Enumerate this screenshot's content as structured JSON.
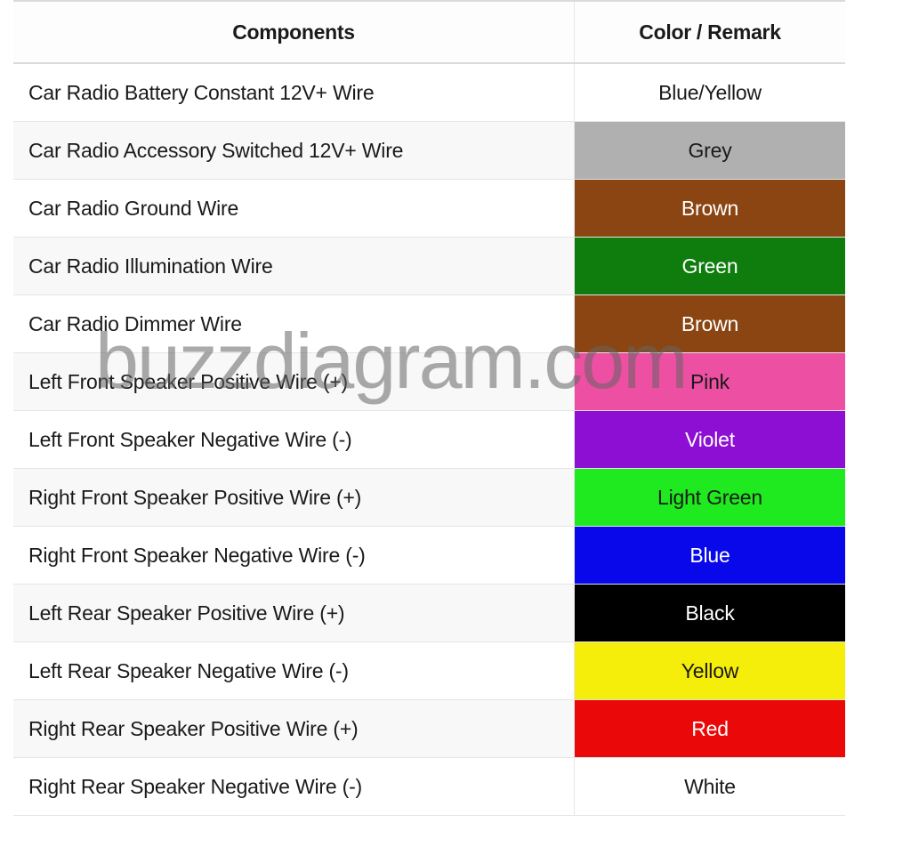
{
  "header": {
    "components": "Components",
    "color": "Color / Remark"
  },
  "watermark": "buzzdiagram.com",
  "rows": [
    {
      "component": "Car Radio Battery Constant 12V+ Wire",
      "label": "Blue/Yellow",
      "bg": "#ffffff",
      "fg": "#1a1a1a",
      "alt_bg": "#ffffff"
    },
    {
      "component": "Car Radio Accessory Switched 12V+ Wire",
      "label": "Grey",
      "bg": "#b0b0b0",
      "fg": "#1a1a1a",
      "alt_bg": "#f8f8f8"
    },
    {
      "component": "Car Radio Ground Wire",
      "label": "Brown",
      "bg": "#8a4513",
      "fg": "#ffffff",
      "alt_bg": "#ffffff"
    },
    {
      "component": "Car Radio Illumination Wire",
      "label": "Green",
      "bg": "#0e7d0e",
      "fg": "#ffffff",
      "alt_bg": "#f8f8f8"
    },
    {
      "component": "Car Radio Dimmer Wire",
      "label": "Brown",
      "bg": "#8a4513",
      "fg": "#ffffff",
      "alt_bg": "#ffffff"
    },
    {
      "component": "Left Front Speaker Positive Wire (+)",
      "label": "Pink",
      "bg": "#ed4fa3",
      "fg": "#1a1a1a",
      "alt_bg": "#f8f8f8"
    },
    {
      "component": "Left Front Speaker Negative Wire (-)",
      "label": "Violet",
      "bg": "#8e0fd4",
      "fg": "#ffffff",
      "alt_bg": "#ffffff"
    },
    {
      "component": "Right Front Speaker Positive Wire (+)",
      "label": "Light Green",
      "bg": "#1fea1f",
      "fg": "#1a1a1a",
      "alt_bg": "#f8f8f8"
    },
    {
      "component": "Right Front Speaker Negative Wire (-)",
      "label": "Blue",
      "bg": "#0808ea",
      "fg": "#ffffff",
      "alt_bg": "#ffffff"
    },
    {
      "component": "Left Rear Speaker Positive Wire (+)",
      "label": "Black",
      "bg": "#000000",
      "fg": "#ffffff",
      "alt_bg": "#f8f8f8"
    },
    {
      "component": "Left Rear Speaker Negative Wire (-)",
      "label": "Yellow",
      "bg": "#f5ed0a",
      "fg": "#1a1a1a",
      "alt_bg": "#ffffff"
    },
    {
      "component": "Right Rear Speaker Positive Wire (+)",
      "label": "Red",
      "bg": "#ea0808",
      "fg": "#ffffff",
      "alt_bg": "#f8f8f8"
    },
    {
      "component": "Right Rear Speaker Negative Wire (-)",
      "label": "White",
      "bg": "#ffffff",
      "fg": "#1a1a1a",
      "alt_bg": "#ffffff"
    }
  ]
}
